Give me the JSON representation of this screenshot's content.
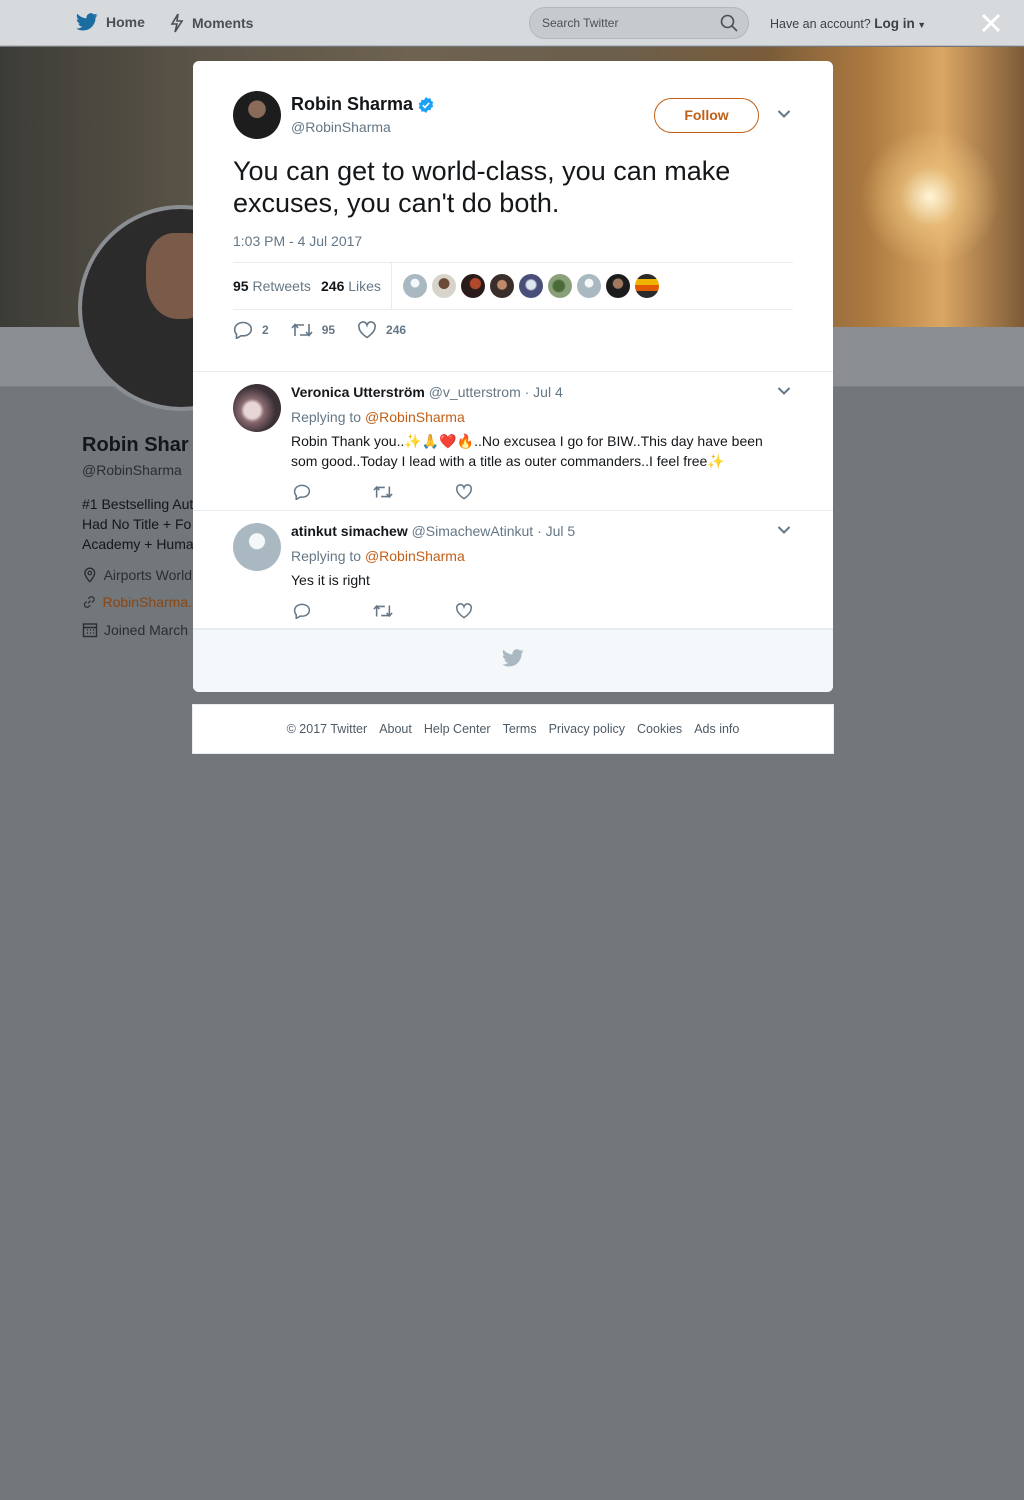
{
  "nav": {
    "home_label": "Home",
    "moments_label": "Moments",
    "search_placeholder": "Search Twitter",
    "account_prompt": "Have an account?",
    "login_label": "Log in"
  },
  "background_profile": {
    "name": "Robin Shar",
    "handle": "@RobinSharma",
    "bio_lines": [
      "#1 Bestselling Aut",
      "Had No Title + Fo",
      "Academy + Huma"
    ],
    "location": "Airports World",
    "website": "RobinSharma.",
    "joined": "Joined March"
  },
  "tweet": {
    "author_name": "Robin Sharma",
    "author_handle": "@RobinSharma",
    "verified": true,
    "follow_label": "Follow",
    "text": "You can get to world-class, you can make excuses, you can't do both.",
    "timestamp": "1:03 PM - 4 Jul 2017",
    "retweets_count": "95",
    "retweets_label": "Retweets",
    "likes_count": "246",
    "likes_label": "Likes",
    "reply_count": "2",
    "retweet_count": "95",
    "like_count": "246"
  },
  "replies": [
    {
      "name": "Veronica Utterström",
      "handle": "@v_utterstrom",
      "date": "· Jul 4",
      "replying_prefix": "Replying to",
      "replying_to": "@RobinSharma",
      "text": "Robin Thank you..✨🙏❤️🔥..No excusea I go for BIW..This day have been som good..Today I lead with a title as outer commanders..I feel free✨"
    },
    {
      "name": "atinkut simachew",
      "handle": "@SimachewAtinkut",
      "date": "· Jul 5",
      "replying_prefix": "Replying to",
      "replying_to": "@RobinSharma",
      "text": "Yes it is right"
    }
  ],
  "footer": {
    "links": [
      "© 2017 Twitter",
      "About",
      "Help Center",
      "Terms",
      "Privacy policy",
      "Cookies",
      "Ads info"
    ]
  },
  "colors": {
    "accent_orange": "#c15f17",
    "twitter_blue": "#1da1f2",
    "overlay_gray": "#72777b",
    "muted_text": "#657786"
  },
  "icons": [
    "twitter-bird-icon",
    "lightning-icon",
    "search-icon",
    "close-icon",
    "verified-badge-icon",
    "chevron-down-icon",
    "reply-icon",
    "retweet-icon",
    "heart-icon",
    "location-icon",
    "link-icon",
    "calendar-icon"
  ]
}
